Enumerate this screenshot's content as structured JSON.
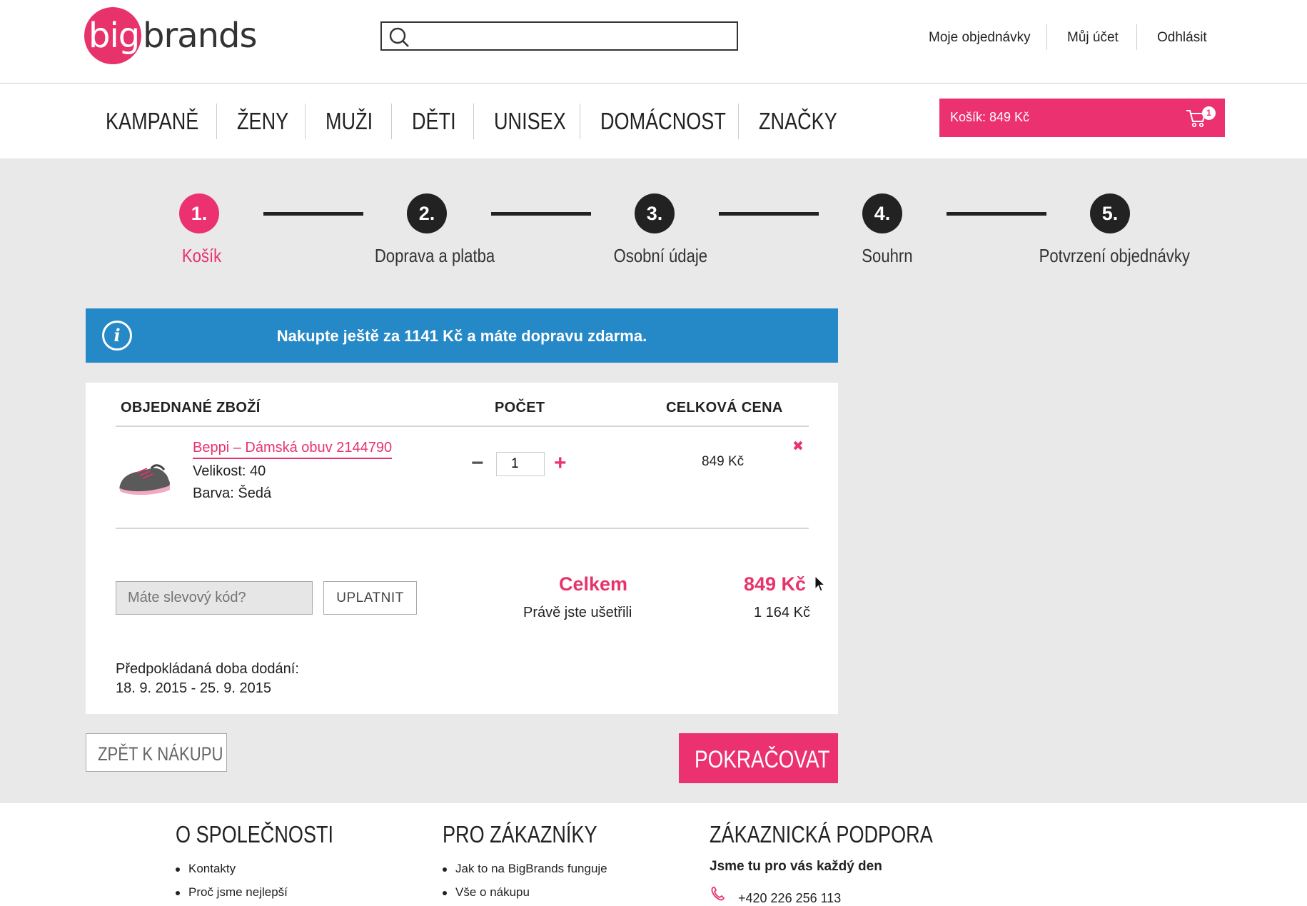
{
  "header": {
    "logo_big": "big",
    "logo_brands": "brands",
    "search_placeholder": "",
    "links": [
      "Moje objednávky",
      "Můj účet",
      "Odhlásit"
    ]
  },
  "nav": {
    "items": [
      "KAMPANĚ",
      "ŽENY",
      "MUŽI",
      "DĚTI",
      "UNISEX",
      "DOMÁCNOST",
      "ZNAČKY"
    ],
    "cart_label": "Košík: 849 Kč",
    "cart_count": "1"
  },
  "steps": [
    {
      "num": "1.",
      "label": "Košík",
      "active": true
    },
    {
      "num": "2.",
      "label": "Doprava a platba",
      "active": false
    },
    {
      "num": "3.",
      "label": "Osobní údaje",
      "active": false
    },
    {
      "num": "4.",
      "label": "Souhrn",
      "active": false
    },
    {
      "num": "5.",
      "label": "Potvrzení objednávky",
      "active": false
    }
  ],
  "info": {
    "icon": "i",
    "message": "Nakupte ještě za 1141 Kč a máte dopravu zdarma."
  },
  "cart_table": {
    "headers": [
      "OBJEDNANÉ ZBOŽÍ",
      "POČET",
      "CELKOVÁ CENA"
    ],
    "item": {
      "name": "Beppi – Dámská obuv 2144790",
      "size": "Velikost: 40",
      "color": "Barva: Šedá",
      "quantity": "1",
      "price": "849 Kč",
      "minus": "−",
      "plus": "+",
      "remove": "✖"
    }
  },
  "summary": {
    "promo_placeholder": "Máte slevový kód?",
    "apply_label": "UPLATNIT",
    "total_label": "Celkem",
    "total_value": "849 Kč",
    "saved_label": "Právě jste ušetřili",
    "saved_value": "1 164 Kč",
    "delivery_label": "Předpokládaná doba dodání:",
    "delivery_dates": "18. 9. 2015 - 25. 9. 2015"
  },
  "actions": {
    "back_label": "ZPĚT K NÁKUPU",
    "continue_label": "POKRAČOVAT"
  },
  "footer": {
    "company": {
      "title": "O SPOLEČNOSTI",
      "items": [
        "Kontakty",
        "Proč jsme nejlepší"
      ]
    },
    "customers": {
      "title": "PRO ZÁKAZNÍKY",
      "items": [
        "Jak to na BigBrands funguje",
        "Vše o nákupu"
      ]
    },
    "support": {
      "title": "ZÁKAZNICKÁ PODPORA",
      "subtitle": "Jsme tu pro vás každý den",
      "phone": "+420 226 256 113"
    }
  },
  "colors": {
    "accent": "#ec3170",
    "info_blue": "#2588c7",
    "background_grey": "#e9e9e9",
    "dark": "#222222"
  }
}
